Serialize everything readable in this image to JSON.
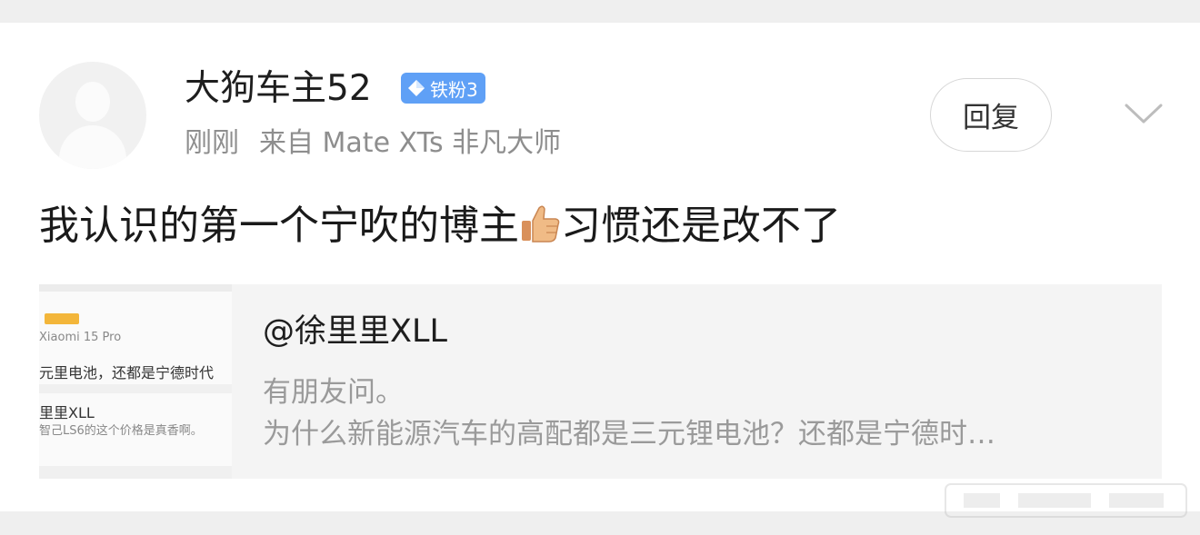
{
  "post": {
    "username": "大狗车主52",
    "badge": "铁粉3",
    "time": "刚刚",
    "source": "来自 Mate XTs 非凡大师",
    "reply_label": "回复",
    "text_before_emoji": "我认识的第一个宁吹的博主",
    "text_after_emoji": "习惯还是改不了",
    "icons": [
      "diamond-icon",
      "thumbs-up-emoji",
      "chevron-down-icon"
    ],
    "badge_color": "#5fa0f6"
  },
  "quote": {
    "user": "@徐里里XLL",
    "line1": "有朋友问。",
    "line2": "为什么新能源汽车的高配都是三元锂电池？还都是宁德时…",
    "thumbnail": {
      "device": "Xiaomi 15 Pro",
      "title": "元里电池，还都是宁德时代",
      "user": "里里XLL",
      "text": "智己LS6的这个价格是真香啊。"
    }
  }
}
